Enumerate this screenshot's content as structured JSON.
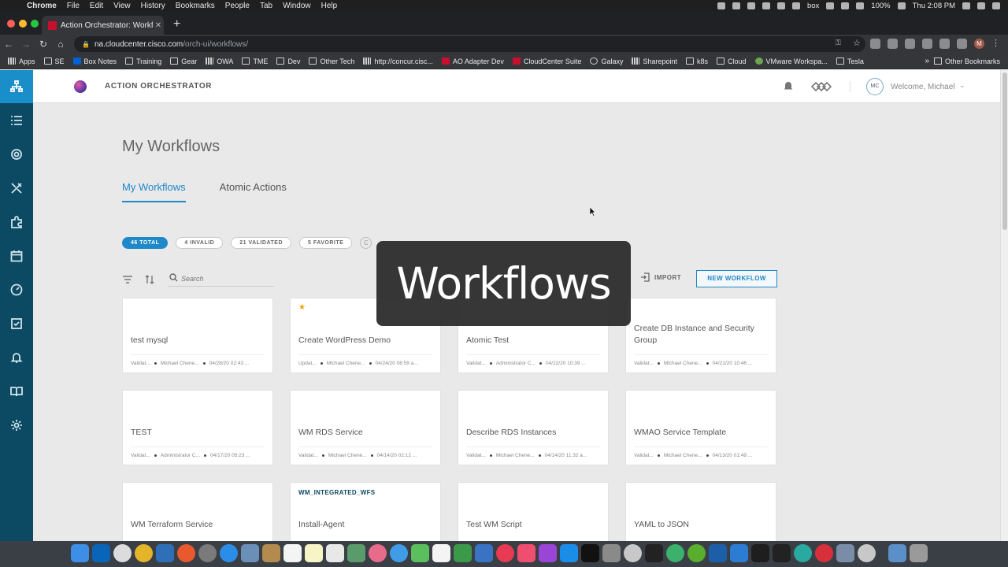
{
  "menubar": {
    "app": "Chrome",
    "items": [
      "File",
      "Edit",
      "View",
      "History",
      "Bookmarks",
      "People",
      "Tab",
      "Window",
      "Help"
    ],
    "battery": "100%",
    "clock": "Thu 2:08 PM",
    "box_label": "box"
  },
  "browser": {
    "tab_title": "Action Orchestrator: Workflows",
    "url_domain": "na.cloudcenter.cisco.com",
    "url_path": "/orch-ui/workflows/",
    "profile_initial": "M"
  },
  "bookmarks": {
    "items": [
      "Apps",
      "SE",
      "Box Notes",
      "Training",
      "Gear",
      "OWA",
      "TME",
      "Dev",
      "Other Tech",
      "http://concur.cisc...",
      "AO Adapter Dev",
      "CloudCenter Suite",
      "Galaxy",
      "Sharepoint",
      "k8s",
      "Cloud",
      "VMware Workspa...",
      "Tesla"
    ],
    "more": "»",
    "other": "Other Bookmarks"
  },
  "header": {
    "title": "ACTION ORCHESTRATOR",
    "avatar_initials": "MC",
    "welcome": "Welcome, Michael"
  },
  "page": {
    "title": "My Workflows",
    "tabs": [
      "My Workflows",
      "Atomic Actions"
    ],
    "filters": [
      "46 TOTAL",
      "4 INVALID",
      "21 VALIDATED",
      "5 FAVORITE"
    ],
    "search_placeholder": "Search",
    "import_label": "IMPORT",
    "new_label": "NEW WORKFLOW"
  },
  "overlay_text": "Workflows",
  "cards": [
    {
      "name": "test mysql",
      "status": "Validat...",
      "owner": "Michael Chene...",
      "date": "04/28/20 02:43 ...",
      "star": "",
      "tag": ""
    },
    {
      "name": "Create WordPress Demo",
      "status": "Updat...",
      "owner": "Michael Chene...",
      "date": "04/24/20 08:59 a...",
      "star": "★",
      "tag": ""
    },
    {
      "name": "Atomic Test",
      "status": "Validat...",
      "owner": "Administrator C...",
      "date": "04/22/20 10:39 ...",
      "star": "",
      "tag": ""
    },
    {
      "name": "Create DB Instance and Security Group",
      "status": "Validat...",
      "owner": "Michael Chene...",
      "date": "04/21/20 10:46 ...",
      "star": "",
      "tag": ""
    },
    {
      "name": "TEST",
      "status": "Validat...",
      "owner": "Administrator C...",
      "date": "04/17/20 05:23 ...",
      "star": "",
      "tag": ""
    },
    {
      "name": "WM RDS Service",
      "status": "Validat...",
      "owner": "Michael Chene...",
      "date": "04/14/20 02:12 ...",
      "star": "",
      "tag": ""
    },
    {
      "name": "Describe RDS Instances",
      "status": "Validat...",
      "owner": "Michael Chene...",
      "date": "04/14/20 11:32 a...",
      "star": "",
      "tag": ""
    },
    {
      "name": "WMAO Service Template",
      "status": "Validat...",
      "owner": "Michael Chene...",
      "date": "04/13/20 01:49 ...",
      "star": "",
      "tag": ""
    },
    {
      "name": "WM Terraform Service",
      "status": "",
      "owner": "",
      "date": "",
      "star": "",
      "tag": ""
    },
    {
      "name": "Install-Agent",
      "status": "",
      "owner": "",
      "date": "",
      "star": "",
      "tag": "WM_INTEGRATED_WFS"
    },
    {
      "name": "Test WM Script",
      "status": "",
      "owner": "",
      "date": "",
      "star": "",
      "tag": ""
    },
    {
      "name": "YAML to JSON",
      "status": "",
      "owner": "",
      "date": "",
      "star": "",
      "tag": ""
    }
  ],
  "colors": {
    "nav_bg": "#0b4a62",
    "nav_active": "#1a8ec9",
    "accent": "#1e88c8",
    "star": "#f0a000"
  }
}
